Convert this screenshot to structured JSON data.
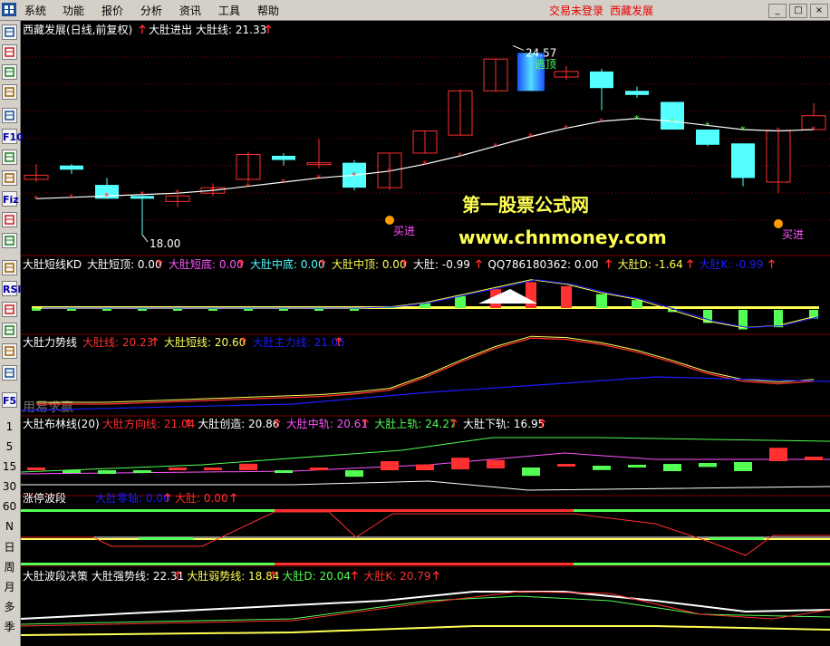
{
  "menu": {
    "items": [
      "系统",
      "功能",
      "报价",
      "分析",
      "资讯",
      "工具",
      "帮助"
    ],
    "status": "交易未登录",
    "stock_name": "西藏发展",
    "window_buttons": [
      "_",
      "□",
      "×"
    ]
  },
  "toolbar": {
    "icons": [
      "stock-list-icon",
      "quote-table-icon",
      "line-chart-icon",
      "kline-icon",
      "multi-window-icon",
      "f10-icon",
      "finance-icon",
      "notes-icon",
      "f-z-icon",
      "index-icon",
      "search-icon",
      "indicator-icon",
      "rsi-icon",
      "money-icon",
      "move-icon",
      "exit-icon",
      "pen-icon",
      "f5-icon"
    ],
    "icon_text": {
      "f10": "F10",
      "fz": "Fiz",
      "rsi": "RSI",
      "f5": "F5"
    },
    "periods": [
      "1",
      "5",
      "15",
      "30",
      "60",
      "N",
      "日",
      "周",
      "月",
      "多",
      "季"
    ]
  },
  "colors": {
    "up": "#ff3030",
    "down": "#54ffff",
    "yellow": "#ffff54",
    "white": "#ffffff",
    "magenta": "#ff54ff",
    "green": "#54ff54",
    "blue": "#1c1cff",
    "grid": "#800000",
    "orange": "#ff9a00"
  },
  "panels": {
    "main": {
      "title": "西藏发展(日线,前复权)",
      "indicator": "大肚进出",
      "ma_label": "大肚线:",
      "ma_value": "21.33",
      "high_label": "24.57",
      "low_label": "18.00",
      "signals": {
        "buy": "买进",
        "top": "逃顶"
      },
      "watermark1": "第一股票公式网",
      "watermark2": "www.chnmoney.com"
    },
    "kd": {
      "title": "大肚短线KD",
      "items": [
        {
          "label": "大肚短顶:",
          "value": "0.00",
          "color": "#ffffff"
        },
        {
          "label": "大肚短底:",
          "value": "0.00",
          "color": "#ff54ff"
        },
        {
          "label": "大肚中底:",
          "value": "0.00",
          "color": "#54ffff"
        },
        {
          "label": "大肚中顶:",
          "value": "0.00",
          "color": "#ffff54"
        },
        {
          "label": "大肚:",
          "value": "-0.99",
          "color": "#ffffff"
        },
        {
          "label": "QQ786180362:",
          "value": "0.00",
          "color": "#ffffff"
        },
        {
          "label": "大肚D:",
          "value": "-1.64",
          "color": "#ffff54"
        },
        {
          "label": "大肚K:",
          "value": "-0.99",
          "color": "#1c1cff"
        }
      ]
    },
    "force": {
      "title": "大肚力势线",
      "items": [
        {
          "label": "大肚线:",
          "value": "20.23",
          "color": "#ff3030"
        },
        {
          "label": "大肚短线:",
          "value": "20.60",
          "color": "#ffff54"
        },
        {
          "label": "大肚主力线:",
          "value": "21.05",
          "color": "#1c1cff"
        }
      ],
      "watermark": "用易求赢"
    },
    "boll": {
      "title": "大肚布林线(20)",
      "items": [
        {
          "label": "大肚方向线:",
          "value": "21.04",
          "color": "#ff3030"
        },
        {
          "label": "大肚创造:",
          "value": "20.86",
          "color": "#ffffff"
        },
        {
          "label": "大肚中轨:",
          "value": "20.61",
          "color": "#ff54ff"
        },
        {
          "label": "大肚上轨:",
          "value": "24.27",
          "color": "#54ff54"
        },
        {
          "label": "大肚下轨:",
          "value": "16.95",
          "color": "#ffffff"
        }
      ]
    },
    "limit": {
      "title": "涨停波段",
      "items": [
        {
          "label": "大肚零轴:",
          "value": "0.00",
          "color": "#1c1cff"
        },
        {
          "label": "大肚:",
          "value": "0.00",
          "color": "#ff3030"
        }
      ]
    },
    "wave": {
      "title": "大肚波段决策",
      "items": [
        {
          "label": "大肚强势线:",
          "value": "22.31",
          "color": "#ffffff"
        },
        {
          "label": "大肚弱势线:",
          "value": "18.84",
          "color": "#ffff54"
        },
        {
          "label": "大肚D:",
          "value": "20.04",
          "color": "#54ff54"
        },
        {
          "label": "大肚K:",
          "value": "20.79",
          "color": "#ff3030"
        }
      ]
    }
  },
  "chart_data": {
    "type": "candlestick",
    "candles": [
      [
        20.0,
        20.55,
        20.15,
        19.9
      ],
      [
        20.5,
        20.55,
        20.35,
        20.2
      ],
      [
        19.8,
        20.05,
        19.3,
        19.3
      ],
      [
        19.4,
        19.5,
        19.3,
        18.0
      ],
      [
        19.2,
        19.45,
        19.4,
        19.0
      ],
      [
        19.5,
        19.85,
        19.7,
        19.4
      ],
      [
        20.0,
        21.0,
        20.9,
        19.9
      ],
      [
        20.85,
        20.95,
        20.7,
        20.5
      ],
      [
        20.6,
        21.45,
        20.6,
        20.4
      ],
      [
        20.6,
        20.7,
        19.7,
        19.6
      ],
      [
        19.7,
        20.95,
        20.95,
        19.6
      ],
      [
        20.95,
        21.75,
        21.75,
        20.95
      ],
      [
        21.6,
        23.25,
        23.2,
        21.6
      ],
      [
        23.2,
        24.35,
        24.35,
        23.2
      ],
      [
        24.35,
        24.57,
        23.2,
        23.2
      ],
      [
        23.7,
        24.1,
        23.9,
        23.6
      ],
      [
        23.9,
        24.0,
        23.3,
        22.5
      ],
      [
        23.2,
        23.35,
        23.05,
        22.95
      ],
      [
        22.8,
        22.8,
        21.8,
        21.8
      ],
      [
        21.8,
        21.8,
        21.25,
        21.2
      ],
      [
        21.3,
        21.3,
        20.05,
        19.75
      ],
      [
        19.9,
        21.75,
        21.75,
        19.5
      ],
      [
        21.8,
        22.75,
        22.3,
        22.3
      ]
    ],
    "kd_bars": [
      0,
      0,
      0,
      0,
      0,
      0,
      0,
      0,
      0,
      0,
      0.1,
      0.5,
      1.2,
      1.9,
      2.6,
      2.2,
      1.4,
      0.8,
      -0.2,
      -1.2,
      -1.8,
      -1.6,
      -0.8
    ],
    "ma": [
      19.3,
      19.35,
      19.4,
      19.45,
      19.5,
      19.6,
      19.75,
      19.9,
      20.05,
      20.15,
      20.3,
      20.55,
      20.85,
      21.2,
      21.55,
      21.85,
      22.1,
      22.2,
      22.1,
      21.95,
      21.8,
      21.75,
      21.8
    ]
  }
}
